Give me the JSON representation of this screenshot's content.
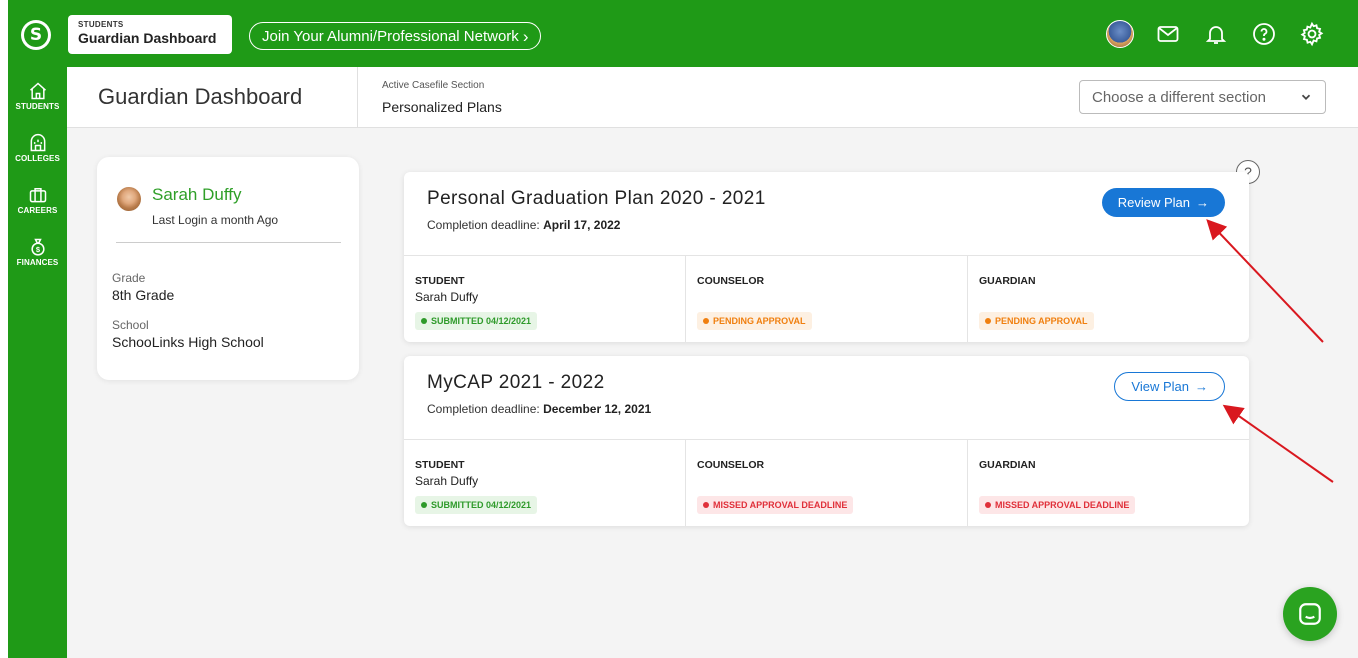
{
  "topbar": {
    "app_small": "STUDENTS",
    "app_title": "Guardian Dashboard",
    "network_button": "Join Your Alumni/Professional Network"
  },
  "sidebar": {
    "items": [
      {
        "label": "STUDENTS",
        "icon": "home-icon"
      },
      {
        "label": "COLLEGES",
        "icon": "college-icon"
      },
      {
        "label": "CAREERS",
        "icon": "briefcase-icon"
      },
      {
        "label": "FINANCES",
        "icon": "money-bag-icon"
      }
    ]
  },
  "header": {
    "title": "Guardian Dashboard",
    "active_label": "Active Casefile Section",
    "active_value": "Personalized Plans",
    "section_select": "Choose a different section"
  },
  "profile": {
    "name": "Sarah Duffy",
    "last_login": "Last Login a month Ago",
    "grade_label": "Grade",
    "grade_value": "8th Grade",
    "school_label": "School",
    "school_value": "SchooLinks High School"
  },
  "plans": [
    {
      "title": "Personal Graduation Plan 2020 - 2021",
      "deadline_prefix": "Completion deadline:",
      "deadline_date": "April 17, 2022",
      "button": "Review Plan",
      "columns": [
        {
          "header": "STUDENT",
          "name": "Sarah Duffy",
          "status": "SUBMITTED 04/12/2021",
          "status_color": "#2e9a2a",
          "status_bg": "#e7f5e6"
        },
        {
          "header": "COUNSELOR",
          "name": "",
          "status": "PENDING APPROVAL",
          "status_color": "#f07f0f",
          "status_bg": "#fdf0e2"
        },
        {
          "header": "GUARDIAN",
          "name": "",
          "status": "PENDING APPROVAL",
          "status_color": "#f07f0f",
          "status_bg": "#fdf0e2"
        }
      ]
    },
    {
      "title": "MyCAP 2021 - 2022",
      "deadline_prefix": "Completion deadline:",
      "deadline_date": "December 12, 2021",
      "button": "View Plan",
      "columns": [
        {
          "header": "STUDENT",
          "name": "Sarah Duffy",
          "status": "SUBMITTED 04/12/2021",
          "status_color": "#2e9a2a",
          "status_bg": "#e7f5e6"
        },
        {
          "header": "COUNSELOR",
          "name": "",
          "status": "MISSED APPROVAL DEADLINE",
          "status_color": "#e0303a",
          "status_bg": "#fde6e7"
        },
        {
          "header": "GUARDIAN",
          "name": "",
          "status": "MISSED APPROVAL DEADLINE",
          "status_color": "#e0303a",
          "status_bg": "#fde6e7"
        }
      ]
    }
  ],
  "colors": {
    "brand_green": "#1f9a17",
    "accent_blue": "#1877d6",
    "annotation_red": "#d9181f"
  }
}
